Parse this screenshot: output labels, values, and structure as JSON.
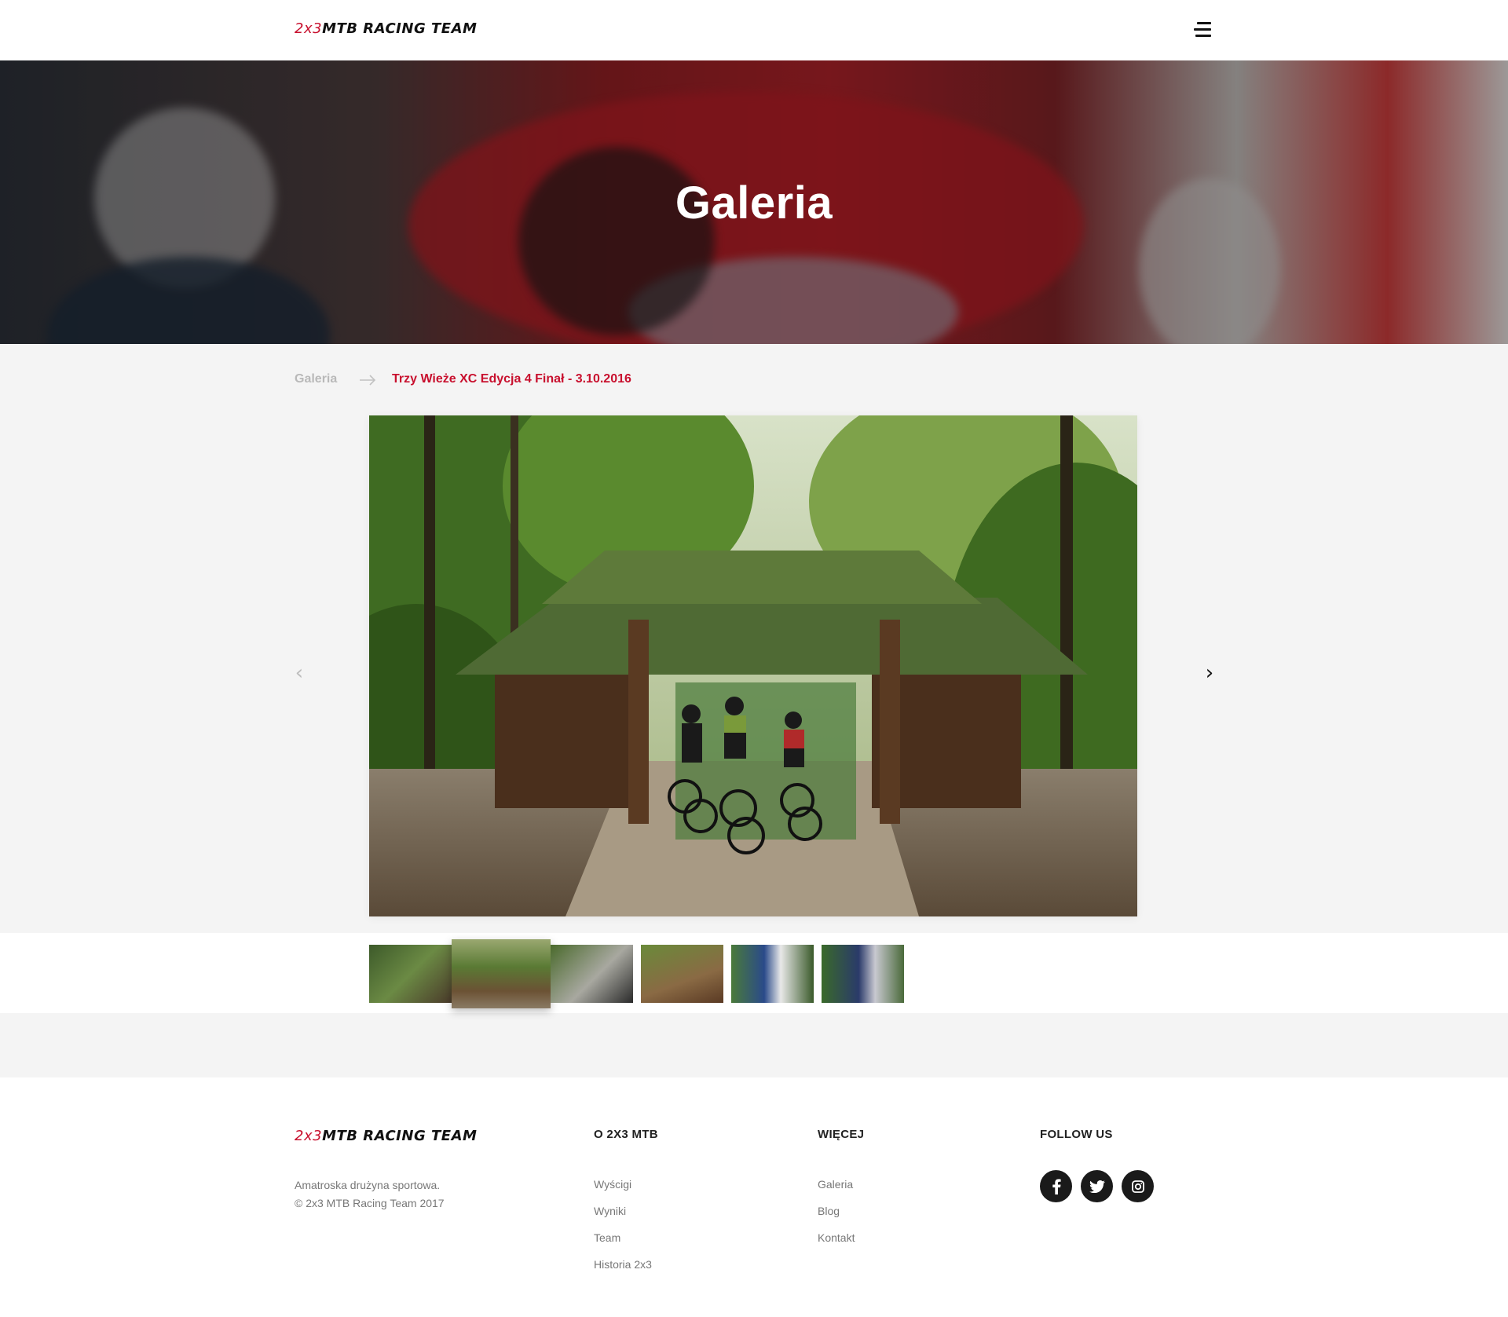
{
  "brand": {
    "accent": "2x3",
    "main": "MTB RACING TEAM",
    "accent_color": "#c8102e"
  },
  "header": {
    "menu_icon": "hamburger-menu-icon"
  },
  "hero": {
    "title": "Galeria"
  },
  "breadcrumb": {
    "root": "Galeria",
    "separator_icon": "arrow-right-icon",
    "current": "Trzy Wieże XC Edycja 4 Finał - 3.10.2016"
  },
  "slider": {
    "prev_icon": "chevron-left-icon",
    "next_icon": "chevron-right-icon",
    "prev_glyph": "‹",
    "next_glyph": "›",
    "active_index": 1,
    "thumbnail_count": 6
  },
  "footer": {
    "description_line1": "Amatroska drużyna sportowa.",
    "description_line2": "© 2x3 MTB Racing Team 2017",
    "col_about_title": "O 2X3 MTB",
    "col_about_links": [
      "Wyścigi",
      "Wyniki",
      "Team",
      "Historia 2x3"
    ],
    "col_more_title": "WIĘCEJ",
    "col_more_links": [
      "Galeria",
      "Blog",
      "Kontakt"
    ],
    "col_follow_title": "FOLLOW US",
    "social_icons": [
      "facebook-icon",
      "twitter-icon",
      "instagram-icon"
    ]
  }
}
